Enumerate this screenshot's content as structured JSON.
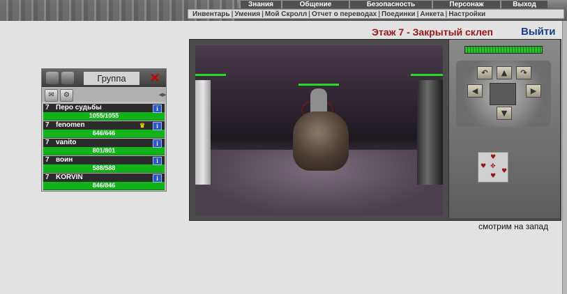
{
  "top_menu": [
    {
      "label": "Знания",
      "w": 58
    },
    {
      "label": "Общение",
      "w": 95
    },
    {
      "label": "Безопасность",
      "w": 117
    },
    {
      "label": "Персонаж",
      "w": 96
    },
    {
      "label": "Выход",
      "w": 66
    }
  ],
  "sub_menu": [
    "Инвентарь",
    "Умения",
    "Мой Скролл",
    "Отчет о переводах",
    "Поединки",
    "Анкета",
    "Настройки"
  ],
  "location": {
    "title": "Этаж 7 - Закрытый склеп",
    "logout": "Выйти"
  },
  "group": {
    "title": "Группа",
    "close_glyph": "✕",
    "members": [
      {
        "level": "7",
        "name": "Перо судьбы",
        "hp": "1055/1055",
        "leader": false
      },
      {
        "level": "7",
        "name": "fenomen",
        "hp": "646/646",
        "leader": true
      },
      {
        "level": "7",
        "name": "vanito",
        "hp": "801/801",
        "leader": false
      },
      {
        "level": "7",
        "name": "воин",
        "hp": "588/588",
        "leader": false
      },
      {
        "level": "7",
        "name": "KORVIN",
        "hp": "846/846",
        "leader": false
      }
    ]
  },
  "view_direction": "смотрим на запад",
  "refresh_progress": 1.0,
  "colors": {
    "location_title": "#9a1616",
    "logout": "#14408c",
    "hp_bar": "#12b21b"
  }
}
